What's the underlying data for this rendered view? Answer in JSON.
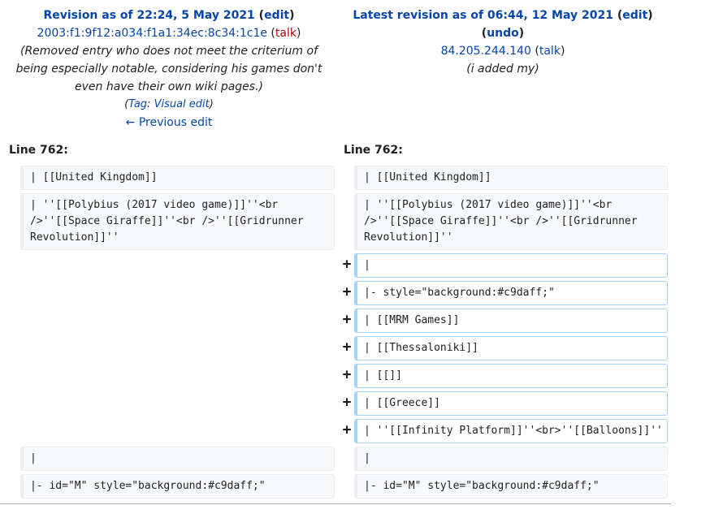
{
  "left": {
    "heading_prefix": "Revision as of 22:24, 5 May 2021",
    "edit_label": "edit",
    "user": "2003:f1:9f12:a034:f1a1:34ec:8c34:1c1e",
    "talk_label": "talk",
    "summary_line1": "(Removed entry who does not meet the criterium of",
    "summary_line2": "being especially notable, considering his games don't",
    "summary_line3": "even have their own wiki pages.)",
    "tag_label": "Tag",
    "tag_value": "Visual edit",
    "prev_edit": "← Previous edit",
    "line_label": "Line 762:"
  },
  "right": {
    "heading_prefix": "Latest revision as of 06:44, 12 May 2021",
    "edit_label": "edit",
    "undo_label": "undo",
    "user": "84.205.244.140",
    "talk_label": "talk",
    "summary": "(i added my)",
    "line_label": "Line 762:"
  },
  "rows": {
    "left": [
      "| [[United Kingdom]]",
      "| ''[[Polybius (2017 video game)]]''<br />''[[Space Giraffe]]''<br />''[[Gridrunner Revolution]]''",
      "|",
      "|- id=\"M\" style=\"background:#c9daff;\""
    ],
    "right_context_top": [
      "| [[United Kingdom]]",
      "| ''[[Polybius (2017 video game)]]''<br />''[[Space Giraffe]]''<br />''[[Gridrunner Revolution]]''"
    ],
    "added": [
      "|",
      "|- style=\"background:#c9daff;\"",
      "| [[MRM Games]]",
      "| [[Thessaloniki]]",
      "| [[]]",
      "| [[Greece]]",
      "| ''[[Infinity Platform]]''<br>''[[Balloons]]''"
    ],
    "right_context_bottom": [
      "|",
      "|- id=\"M\" style=\"background:#c9daff;\""
    ],
    "add_marker": "+"
  }
}
